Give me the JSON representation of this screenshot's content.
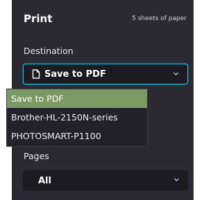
{
  "header": {
    "title": "Print",
    "sheets_text": "5 sheets of paper"
  },
  "destination": {
    "label": "Destination",
    "selected": "Save to PDF",
    "icon": "document-icon",
    "options": [
      "Save to PDF",
      "Brother-HL-2150N-series",
      "PHOTOSMART-P1100"
    ]
  },
  "pages": {
    "label": "Pages",
    "selected": "All"
  },
  "colors": {
    "panel_bg": "#2b2a33",
    "focus_ring": "#00c8ee",
    "selected_option": "#7a9a63"
  }
}
